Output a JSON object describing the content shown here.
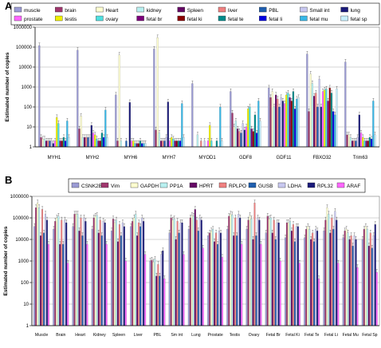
{
  "chart_data": [
    {
      "type": "bar",
      "panel_letter": "A",
      "ylabel": "Estimated number of copies",
      "yscale": "log",
      "ylim": [
        1,
        1000000
      ],
      "yticks": [
        "1",
        "10",
        "100",
        "1000",
        "10000",
        "100000",
        "1000000"
      ],
      "legend_position": "top",
      "categories": [
        "MYH1",
        "MYH2",
        "MYH6",
        "MYH7",
        "MYOD1",
        "GDF8",
        "GDF11",
        "FBXO32",
        "Trim63"
      ],
      "series": [
        {
          "name": "muscle",
          "color": "#9b9bd4",
          "values": [
            120000,
            70000,
            400,
            80000,
            1500,
            600,
            900,
            45000,
            18000
          ]
        },
        {
          "name": "brain",
          "color": "#a0366e",
          "values": [
            3,
            8,
            2,
            7,
            1,
            50,
            300,
            60,
            4
          ]
        },
        {
          "name": "Heart",
          "color": "#ffffd0",
          "values": [
            2.5,
            35,
            40000,
            300000,
            1,
            10,
            600,
            4500,
            4
          ]
        },
        {
          "name": "kidney",
          "color": "#b8f0f0",
          "values": [
            2.5,
            3,
            2,
            5,
            4,
            20,
            100,
            1500,
            3
          ]
        },
        {
          "name": "Spleen",
          "color": "#650865",
          "values": [
            2,
            3,
            1,
            2,
            1,
            8,
            400,
            350,
            2
          ]
        },
        {
          "name": "liver",
          "color": "#f08080",
          "values": [
            2,
            3,
            1,
            2,
            2,
            6,
            250,
            500,
            2
          ]
        },
        {
          "name": "PBL",
          "color": "#1f5fb0",
          "values": [
            2,
            3,
            2,
            2,
            1,
            5,
            100,
            100,
            2
          ]
        },
        {
          "name": "Small int",
          "color": "#c8c8f0",
          "values": [
            2,
            3,
            1,
            3,
            2,
            15,
            300,
            2500,
            3
          ]
        },
        {
          "name": "lung",
          "color": "#1a1a7a",
          "values": [
            1.5,
            12,
            170,
            180,
            1,
            7,
            200,
            100,
            40
          ]
        },
        {
          "name": "prostate",
          "color": "#ff66ff",
          "values": [
            2,
            5,
            2,
            2,
            2,
            10,
            150,
            600,
            5
          ]
        },
        {
          "name": "testis",
          "color": "#f0f000",
          "values": [
            30,
            4,
            2,
            3,
            12,
            80,
            400,
            700,
            3
          ]
        },
        {
          "name": "ovary",
          "color": "#4fe0e0",
          "values": [
            15,
            2.5,
            1.5,
            2.5,
            2,
            100,
            500,
            800,
            2
          ]
        },
        {
          "name": "fetal br",
          "color": "#7b007b",
          "values": [
            2,
            2,
            1.5,
            2,
            1,
            8,
            300,
            200,
            2
          ]
        },
        {
          "name": "fetal ki",
          "color": "#8b0000",
          "values": [
            2,
            2,
            1.5,
            2,
            1,
            6,
            200,
            900,
            2
          ]
        },
        {
          "name": "fetal te",
          "color": "#008b8b",
          "values": [
            3,
            5,
            2,
            2,
            2,
            40,
            600,
            500,
            3
          ]
        },
        {
          "name": "fetal li",
          "color": "#0000e0",
          "values": [
            2,
            3,
            1.5,
            2,
            1,
            5,
            80,
            60,
            2.5
          ]
        },
        {
          "name": "fetal mu",
          "color": "#38b8e8",
          "values": [
            20,
            70,
            1.5,
            150,
            100,
            200,
            250,
            40,
            200
          ]
        },
        {
          "name": "fetal sp",
          "color": "#c8f0ff",
          "values": [
            3,
            3,
            1.5,
            3,
            2,
            20,
            300,
            800,
            4
          ]
        }
      ]
    },
    {
      "type": "bar",
      "panel_letter": "B",
      "ylabel": "Estimated number of copies",
      "yscale": "log",
      "ylim": [
        1,
        1000000
      ],
      "yticks": [
        "1",
        "10",
        "100",
        "1000",
        "10000",
        "100000",
        "1000000"
      ],
      "legend_position": "top",
      "categories": [
        "Muscle",
        "Brain",
        "Heart",
        "Kidney",
        "Spleen",
        "Liver",
        "PBL",
        "Sm int",
        "Lung",
        "Prostate",
        "Testis",
        "Ovary",
        "Fetal Br",
        "Fetal Ki",
        "Fetal Te",
        "Fetal Li",
        "Fetal Mu",
        "Fetal Sp"
      ],
      "series": [
        {
          "name": "CSNK2B",
          "color": "#9b9bd4",
          "values": [
            40000,
            30000,
            40000,
            30000,
            25000,
            40000,
            1000,
            20000,
            30000,
            15000,
            30000,
            30000,
            20000,
            12000,
            12000,
            25000,
            12000,
            10000
          ]
        },
        {
          "name": "Vim",
          "color": "#a0366e",
          "values": [
            300000,
            70000,
            150000,
            100000,
            90000,
            70000,
            1100,
            100000,
            100000,
            20000,
            120000,
            80000,
            120000,
            60000,
            30000,
            80000,
            25000,
            30000
          ]
        },
        {
          "name": "GAPDH",
          "color": "#ffffd0",
          "values": [
            500000,
            100000,
            150000,
            120000,
            60000,
            100000,
            900,
            80000,
            130000,
            25000,
            150000,
            130000,
            90000,
            60000,
            40000,
            300000,
            30000,
            40000
          ]
        },
        {
          "name": "PP1A",
          "color": "#b8f0f0",
          "values": [
            300000,
            120000,
            150000,
            130000,
            80000,
            150000,
            1200,
            90000,
            120000,
            30000,
            140000,
            90000,
            100000,
            70000,
            30000,
            150000,
            20000,
            30000
          ]
        },
        {
          "name": "HPRT",
          "color": "#650865",
          "values": [
            15000,
            6000,
            25000,
            20000,
            8000,
            15000,
            200,
            10000,
            250000,
            8000,
            15000,
            10000,
            20000,
            25000,
            10000,
            20000,
            10000,
            5000
          ]
        },
        {
          "name": "RPLPO",
          "color": "#f08080",
          "values": [
            250000,
            80000,
            100000,
            80000,
            50000,
            60000,
            700,
            70000,
            80000,
            20000,
            100000,
            500000,
            80000,
            50000,
            20000,
            100000,
            15000,
            20000
          ]
        },
        {
          "name": "GUSB",
          "color": "#1f5fb0",
          "values": [
            20000,
            6000,
            15000,
            15000,
            15000,
            40000,
            200,
            20000,
            25000,
            6000,
            15000,
            15000,
            10000,
            8000,
            8000,
            30000,
            5000,
            4000
          ]
        },
        {
          "name": "LDHA",
          "color": "#c8c8f0",
          "values": [
            150000,
            80000,
            100000,
            70000,
            60000,
            100000,
            2000,
            60000,
            100000,
            25000,
            150000,
            100000,
            60000,
            40000,
            30000,
            200000,
            15000,
            15000
          ]
        },
        {
          "name": "RPL32",
          "color": "#1a1a7a",
          "values": [
            80000,
            60000,
            70000,
            60000,
            40000,
            70000,
            3000,
            60000,
            80000,
            20000,
            100000,
            80000,
            60000,
            40000,
            25000,
            80000,
            10000,
            50000
          ]
        },
        {
          "name": "ARAF",
          "color": "#ff66ff",
          "values": [
            6000,
            800,
            6000,
            6000,
            1000,
            2000,
            150,
            2000,
            4000,
            1500,
            6000,
            6000,
            1000,
            800,
            150,
            800,
            500,
            300
          ]
        }
      ]
    }
  ]
}
